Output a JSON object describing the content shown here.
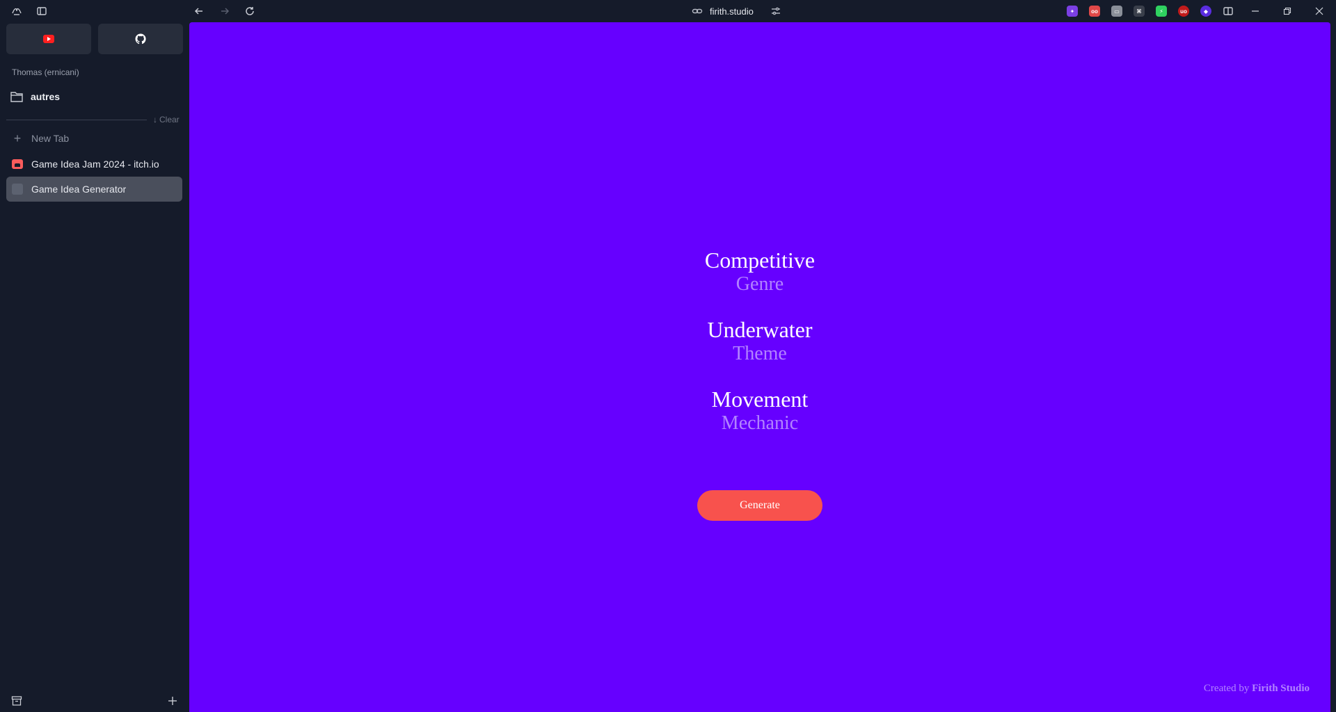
{
  "browser": {
    "url": "firith.studio",
    "extensions": [
      {
        "icon": "wand-extension-icon",
        "color": "#7b3fe4"
      },
      {
        "icon": "eyes-extension-icon",
        "color": "#e04848"
      },
      {
        "icon": "reader-extension-icon",
        "color": "#8a8f99"
      },
      {
        "icon": "grid-extension-icon",
        "color": "#3a3f4b"
      },
      {
        "icon": "battery-extension-icon",
        "color": "#2fd160"
      },
      {
        "icon": "ublock-extension-icon",
        "color": "#c21b1b"
      },
      {
        "icon": "vpn-extension-icon",
        "color": "#5a2de0"
      }
    ]
  },
  "sidebar": {
    "profile": "Thomas (ernicani)",
    "folder": "autres",
    "clear_label": "Clear",
    "new_tab_label": "New Tab",
    "tabs": [
      {
        "title": "Game Idea Jam 2024 - itch.io",
        "active": false
      },
      {
        "title": "Game Idea Generator",
        "active": true
      }
    ]
  },
  "page": {
    "ideas": [
      {
        "value": "Competitive",
        "label": "Genre"
      },
      {
        "value": "Underwater",
        "label": "Theme"
      },
      {
        "value": "Movement",
        "label": "Mechanic"
      }
    ],
    "generate_label": "Generate",
    "credit_prefix": "Created by",
    "credit_name": "Firith Studio"
  },
  "colors": {
    "background": "#6600ff",
    "accent_button": "#f8524d",
    "label_purple": "#b283ff"
  }
}
